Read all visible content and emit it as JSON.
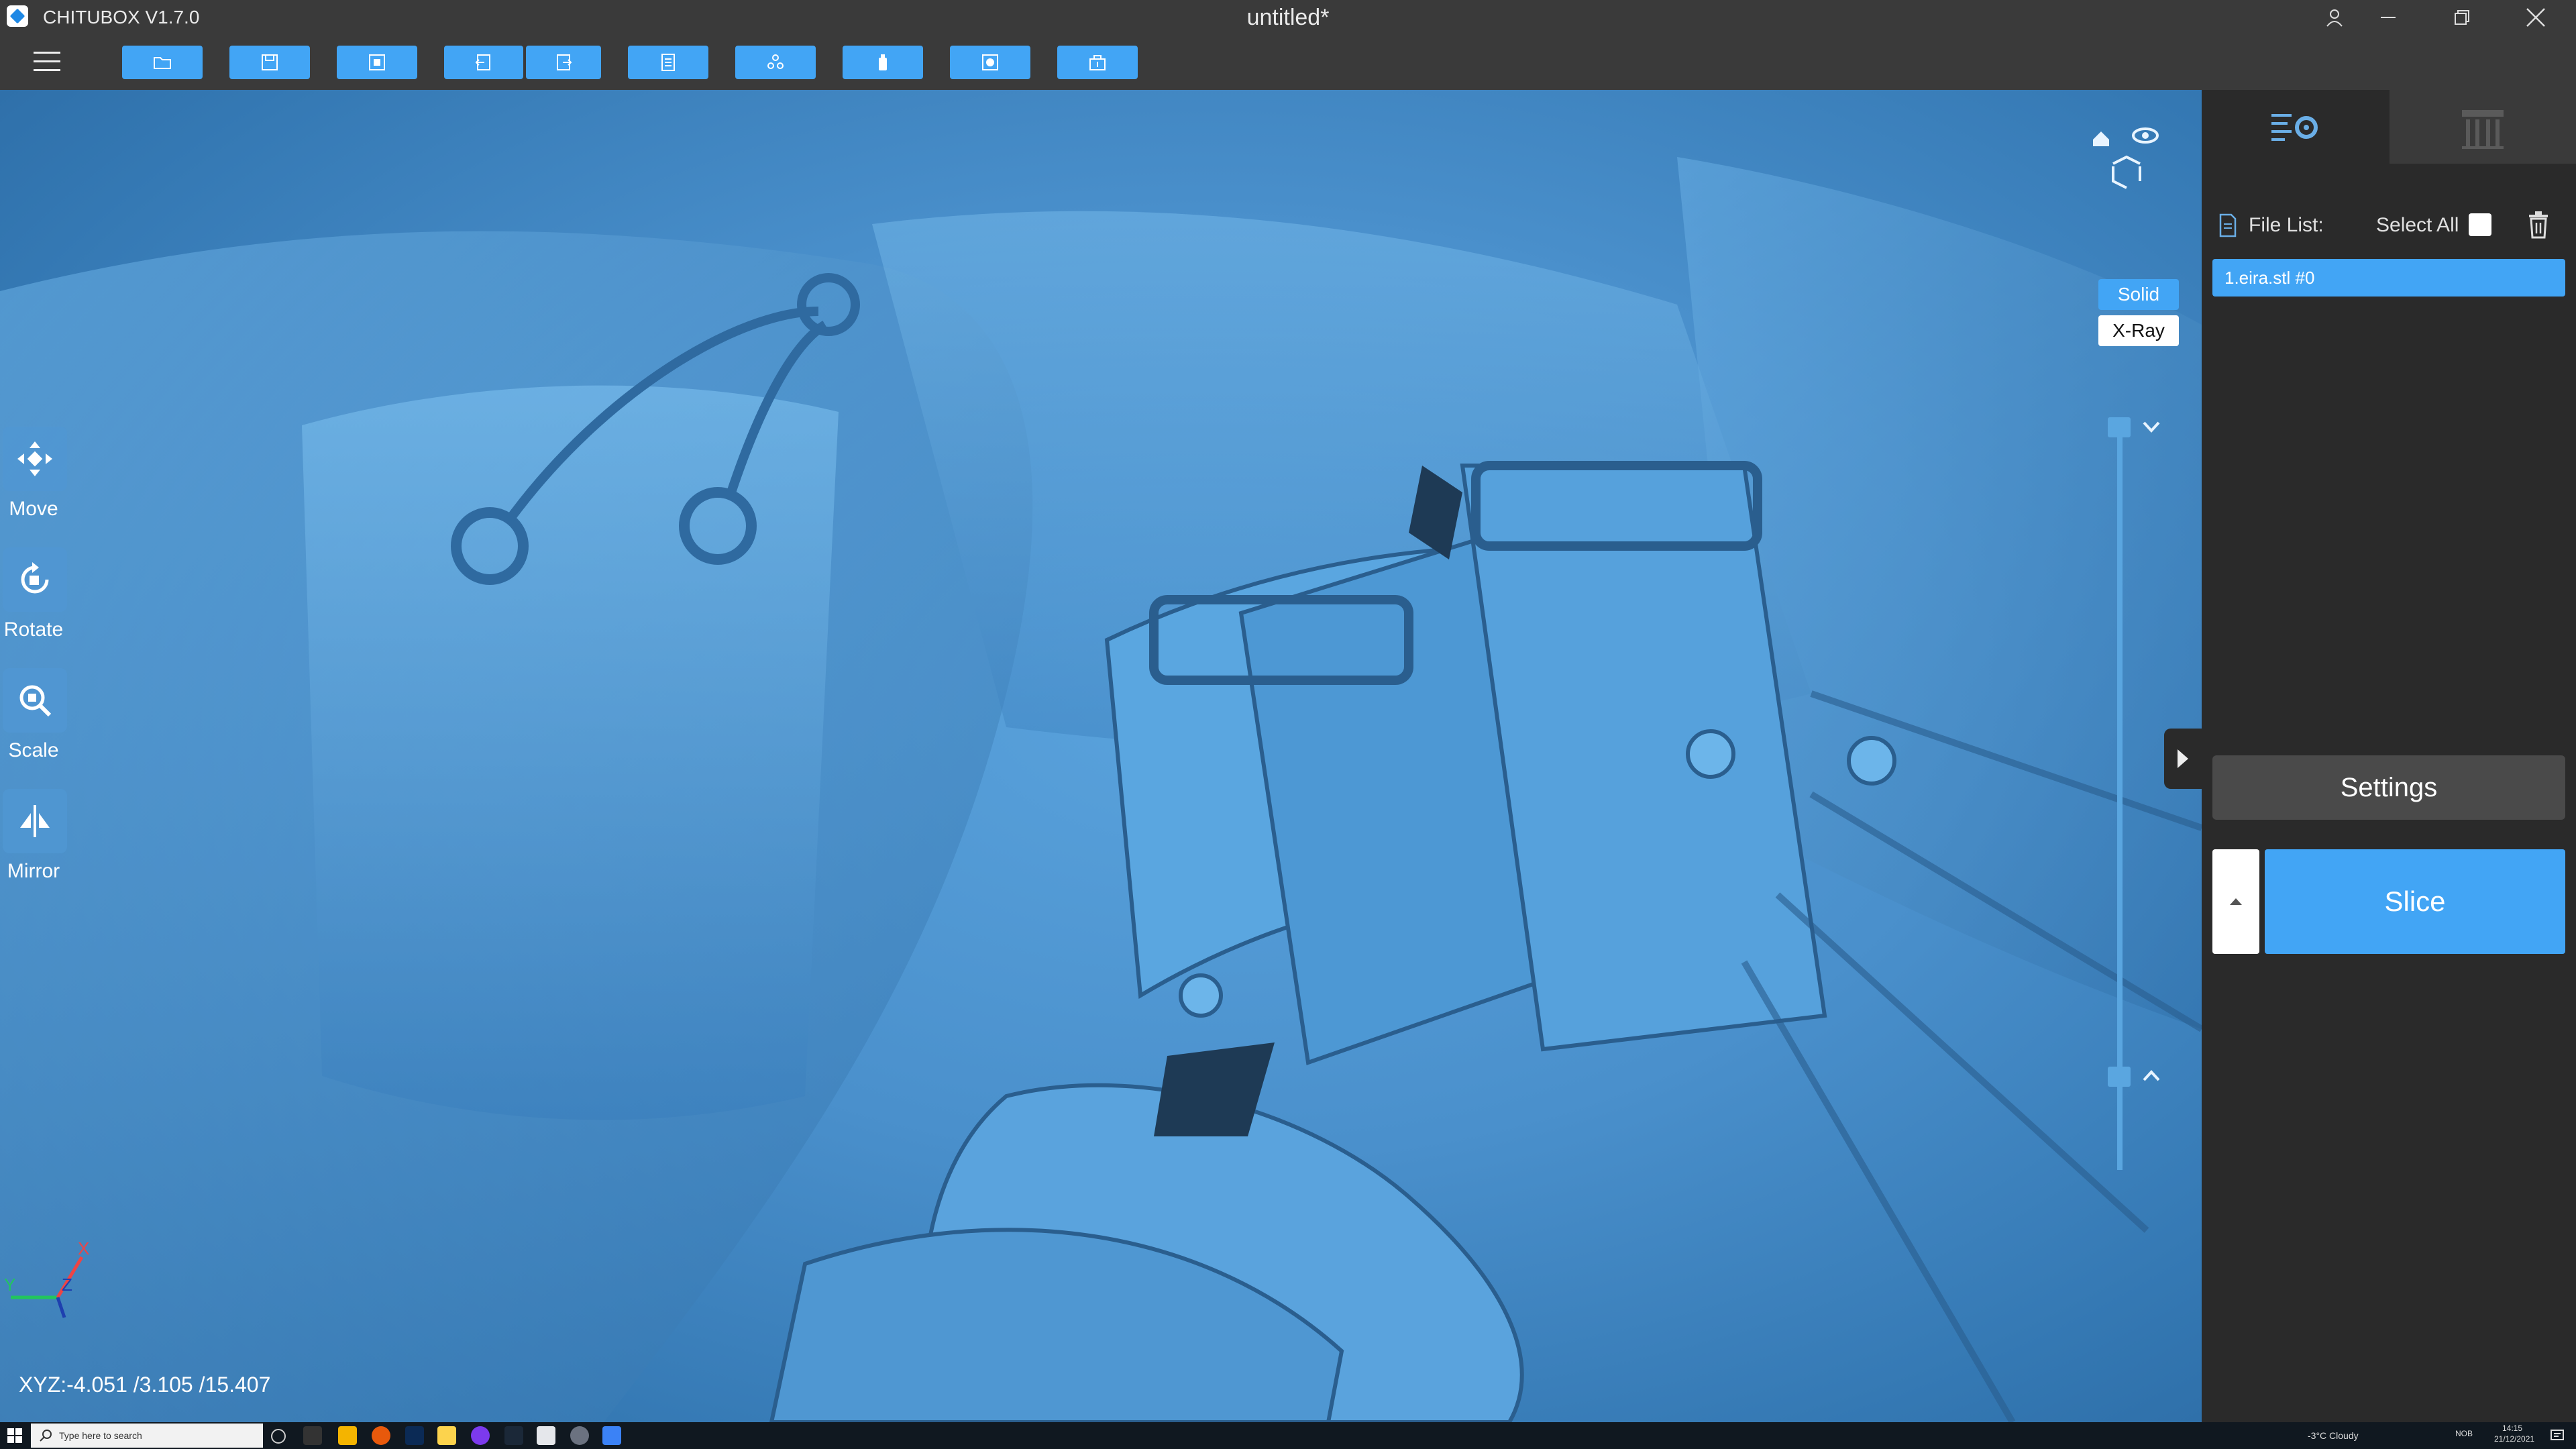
{
  "app": {
    "title": "CHITUBOX V1.7.0",
    "document_title": "untitled*"
  },
  "toolbar": {
    "buttons": [
      {
        "name": "open-file"
      },
      {
        "name": "save"
      },
      {
        "name": "auto-layout"
      },
      {
        "name": "undo"
      },
      {
        "name": "redo"
      },
      {
        "name": "model-info"
      },
      {
        "name": "supports"
      },
      {
        "name": "hollow"
      },
      {
        "name": "dig-hole"
      },
      {
        "name": "export"
      }
    ]
  },
  "left_tools": [
    {
      "label": "Move",
      "icon": "move-icon"
    },
    {
      "label": "Rotate",
      "icon": "rotate-icon"
    },
    {
      "label": "Scale",
      "icon": "scale-icon"
    },
    {
      "label": "Mirror",
      "icon": "mirror-icon"
    }
  ],
  "view_modes": {
    "solid": "Solid",
    "xray": "X-Ray",
    "active": "Solid"
  },
  "coordinates": "XYZ:-4.051 /3.105 /15.407",
  "right_panel": {
    "file_list_label": "File List:",
    "select_all_label": "Select All",
    "files": [
      "1.eira.stl #0"
    ],
    "settings_label": "Settings",
    "slice_label": "Slice"
  },
  "taskbar": {
    "search_placeholder": "Type here to search",
    "weather": "-3°C  Cloudy",
    "language": "NOB",
    "time": "14:15",
    "date": "21/12/2021"
  },
  "colors": {
    "accent": "#42a5f5",
    "model": "#4a90cc",
    "panel": "#2a2a2a",
    "titlebar": "#3a3a3a"
  }
}
